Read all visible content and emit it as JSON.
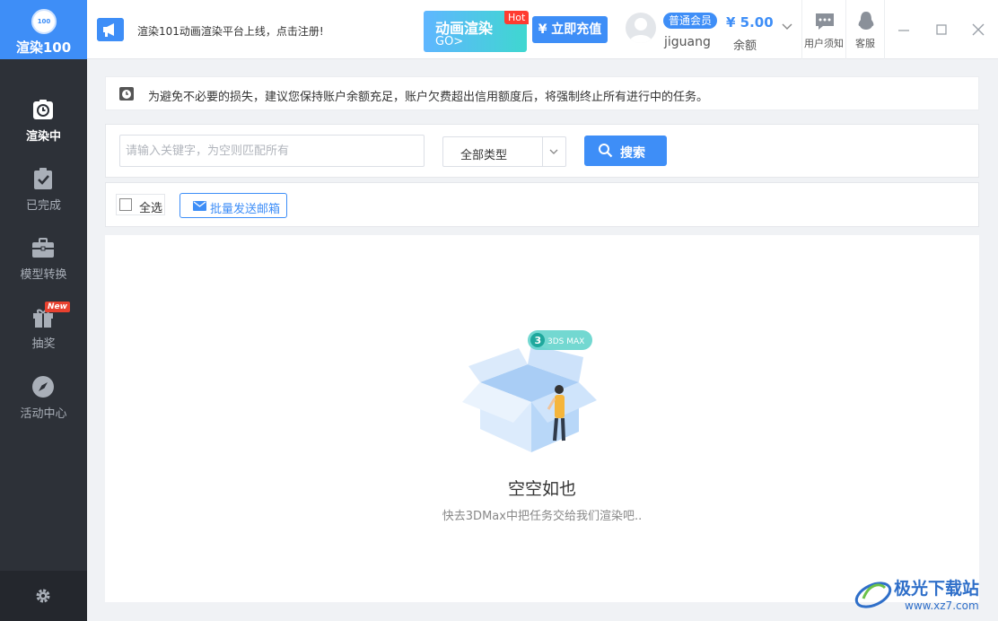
{
  "app": {
    "logo_mark": "100",
    "name": "渲染100"
  },
  "sidebar": {
    "items": [
      {
        "label": "渲染中",
        "icon": "clock-icon",
        "active": true
      },
      {
        "label": "已完成",
        "icon": "clipboard-check-icon"
      },
      {
        "label": "模型转换",
        "icon": "briefcase-icon"
      },
      {
        "label": "抽奖",
        "icon": "gift-icon",
        "badge": "New"
      },
      {
        "label": "活动中心",
        "icon": "compass-icon"
      }
    ],
    "settings_icon": "gear-icon"
  },
  "topbar": {
    "notice": "渲染101动画渲染平台上线，点击注册!",
    "promo": {
      "title": "动画渲染",
      "go": "GO>",
      "hot": "Hot"
    },
    "recharge_label": "¥ 立即充值",
    "user": {
      "member_level": "普通会员",
      "username": "jiguang"
    },
    "balance": {
      "amount": "¥ 5.00",
      "label": "余额"
    },
    "tools": [
      {
        "label": "用户须知",
        "icon": "chat-bubble-icon"
      },
      {
        "label": "客服",
        "icon": "qq-penguin-icon"
      }
    ]
  },
  "warning": {
    "text": "为避免不必要的损失，建议您保持账户余额充足，账户欠费超出信用额度后，将强制终止所有进行中的任务。"
  },
  "search": {
    "placeholder": "请输入关键字，为空则匹配所有",
    "value": "",
    "type_selected": "全部类型",
    "button_label": "搜索"
  },
  "actions": {
    "select_all_label": "全选",
    "batch_email_label": "批量发送邮箱"
  },
  "empty_state": {
    "badge": "3DS MAX",
    "title": "空空如也",
    "subtitle": "快去3DMax中把任务交给我们渲染吧.."
  },
  "watermark": {
    "name": "极光下载站",
    "url": "www.xz7.com"
  },
  "colors": {
    "accent": "#3e8ef7",
    "sidebar": "#2d3138",
    "hot": "#ff3b30",
    "new_badge": "#e8412f"
  }
}
